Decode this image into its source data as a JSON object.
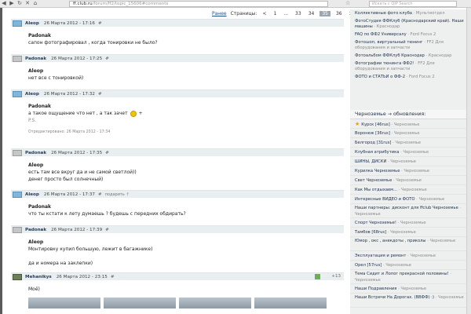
{
  "browser": {
    "url_main": "ff.club.ru",
    "url_rest": "/forum/ff2/topic_15606#comments",
    "search_placeholder": "Искать с QIP Search"
  },
  "pager": {
    "prev": "Ранее",
    "label": "Страницы:",
    "prev_arrow": "<",
    "pages": [
      "1",
      "...",
      "33",
      "34",
      "35",
      "36"
    ],
    "current_page": "35",
    "next_arrow": ">"
  },
  "comments": [
    {
      "author": "Aleop",
      "date": "26 Марта 2012 - 17:16",
      "hash": "#",
      "avatar": "blue",
      "addressee": "Padonak",
      "lines": [
        "сапон фотографировал , когда тонировки не было?"
      ]
    },
    {
      "author": "Padonak",
      "date": "26 Марта 2012 - 17:25",
      "hash": "#",
      "avatar": "gray",
      "addressee": "Aleop",
      "lines": [
        "нет все с тонировкой)"
      ]
    },
    {
      "author": "Aleop",
      "date": "26 Марта 2012 - 17:32",
      "hash": "#",
      "avatar": "blue",
      "addressee": "Padonak",
      "lines": [
        "а такое ощущение что нет , а так зачет"
      ],
      "smiley_suffix": "+",
      "ps": "P.S.",
      "edited": "Отредактировано: 26 Марта 2012 - 17:34"
    },
    {
      "author": "Padonak",
      "date": "26 Марта 2012 - 17:35",
      "hash": "#",
      "avatar": "gray",
      "addressee": "Aleop",
      "lines": [
        "есть там все вкруг да и не самой светлой))",
        "денег просто был солнечный)"
      ]
    },
    {
      "author": "Aleop",
      "date": "26 Марта 2012 - 17:37",
      "hash": "#",
      "avatar": "blue",
      "reply": "подарить ↑",
      "addressee": "Padonak",
      "lines": [
        "что ты кстати к лету думаешь ? будешь с передних обдирать?"
      ]
    },
    {
      "author": "Padonak",
      "date": "26 Марта 2012 - 17:39",
      "hash": "#",
      "avatar": "gray",
      "addressee": "Aleop",
      "lines": [
        "Монтировку купил большую, лежит в багажнике)",
        "",
        "да и номера на заклепки)"
      ]
    },
    {
      "author": "Mehanikys",
      "date": "26 Марта 2012 - 23:15",
      "hash": "#",
      "avatar": "dark",
      "score": "+13",
      "addressee": "",
      "lines": [
        "Моё)"
      ]
    }
  ],
  "sidebar": {
    "top_items": [
      {
        "title": "Коллективные фото клуба",
        "sub": "· Мультиотдел"
      },
      {
        "title": "ФотоСтудия ФФКлуб (Краснодарский край). Наши машины",
        "sub": "· Краснодар"
      },
      {
        "title": "FAQ по ФФ2 Универсалу",
        "sub": "· Ford Focus 2"
      },
      {
        "title": "Фотошоп, виртуальный тюнинг",
        "sub": "· FF2 Для оборудования и запчасти"
      },
      {
        "title": "Фотоальбом ФФКлуб Краснодар",
        "sub": "· Краснодар"
      },
      {
        "title": "Фотографии тюнинга ФФ2!",
        "sub": "· FF2 Для оборудования и запчасти"
      },
      {
        "title": "ФОТО и СТАТЬИ о ФФ-2",
        "sub": "· Ford Focus 2"
      }
    ],
    "updates_title": "Черноземье → обновления:",
    "updates": [
      {
        "title": "Курск [46rus]",
        "sub": "· Черноземье",
        "star": true
      },
      {
        "title": "Воронеж [36rus]",
        "sub": "· Черноземье"
      },
      {
        "title": "Белгород [31rus]",
        "sub": "· Черноземье"
      },
      {
        "title": "Клубная атрибутика",
        "sub": "· Черноземье"
      },
      {
        "title": "ШИНЫ, ДИСКИ",
        "sub": "· Черноземье"
      },
      {
        "title": "Курилка Черноземье",
        "sub": "· Черноземье"
      },
      {
        "title": "Свет Черноземье",
        "sub": "· Черноземье"
      },
      {
        "title": "Как Мы отдыхаем...",
        "sub": "· Черноземье"
      },
      {
        "title": "Интересные ВИДЕО и ФОТО",
        "sub": "· Черноземье"
      },
      {
        "title": "Наши партнеры: дисконт для ffclub Черноземье",
        "sub": "· Черноземье",
        "two": true
      },
      {
        "title": "Спорт Черноземье!",
        "sub": "· Черноземье"
      },
      {
        "title": "Тамбов [68rus]",
        "sub": "· Черноземье"
      },
      {
        "title": "Юмор , окс , анекдоты , приколы",
        "sub": "· Черноземье",
        "two": true
      },
      {
        "title": "Эксплуатация и ремонт",
        "sub": "· Черноземье"
      },
      {
        "title": "Орел [57rus]",
        "sub": "· Черноземье"
      },
      {
        "title": "Тема Сидит и Лопог прекрасной половины!",
        "sub": "· Черноземье",
        "two": true
      },
      {
        "title": "Наши Подравления",
        "sub": "· Черноземье"
      },
      {
        "title": "Наши Встречи На Дорогах. (ВВФФ) :)",
        "sub": "· Черноземье",
        "two": true
      }
    ]
  }
}
